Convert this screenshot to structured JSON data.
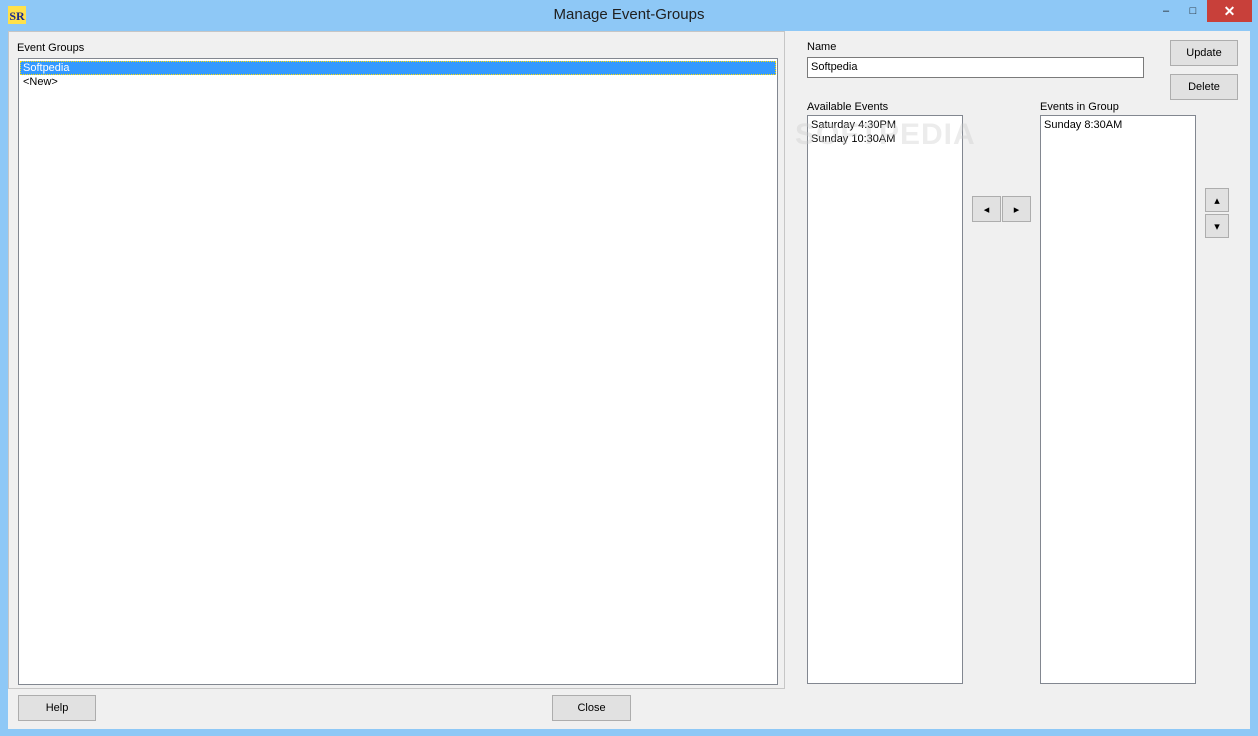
{
  "window": {
    "title": "Manage Event-Groups",
    "icon_text": "SR",
    "min_symbol": "–",
    "max_symbol": "□",
    "close_symbol": "✕"
  },
  "event_groups": {
    "label": "Event Groups",
    "items": [
      {
        "label": "Softpedia",
        "selected": true
      },
      {
        "label": "<New>",
        "selected": false
      }
    ]
  },
  "name": {
    "label": "Name",
    "value": "Softpedia"
  },
  "buttons": {
    "update": "Update",
    "delete": "Delete",
    "help": "Help",
    "close": "Close",
    "move_left": "◂",
    "move_right": "▸",
    "move_up": "▴",
    "move_down": "▾"
  },
  "available_events": {
    "label": "Available Events",
    "items": [
      "Saturday 4:30PM",
      "Sunday 10:30AM"
    ]
  },
  "events_in_group": {
    "label": "Events in Group",
    "items": [
      "Sunday 8:30AM"
    ]
  },
  "watermark": "SOFTPEDIA",
  "colors": {
    "title_bar": "#8ec8f6",
    "selection": "#3399ff",
    "close_button": "#c8403a",
    "dialog_bg": "#f0f0f0"
  }
}
